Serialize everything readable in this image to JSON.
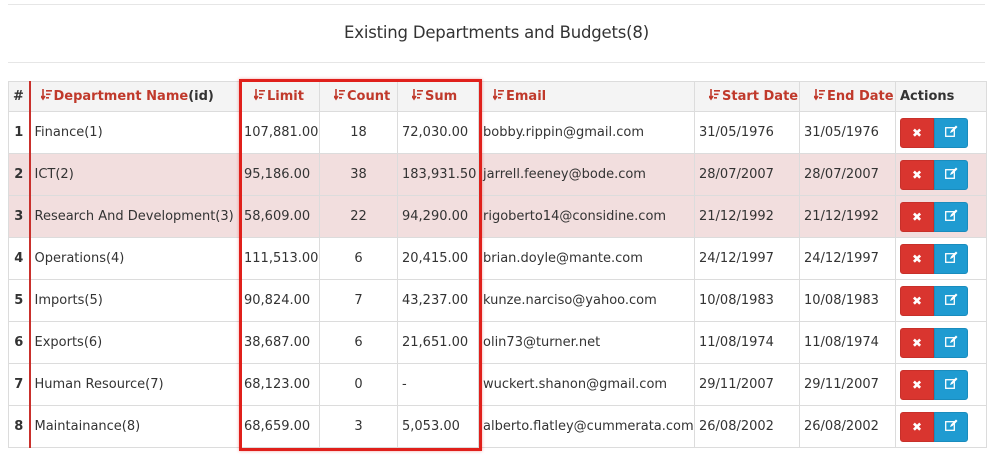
{
  "page_title": "Existing Departments and Budgets(8)",
  "colors": {
    "header_text": "#c0392b",
    "row_alt": "#f2dede",
    "delete_btn": "#d9352f",
    "edit_btn": "#1f9bd1",
    "highlight": "#e0201b"
  },
  "table": {
    "headers": {
      "hash": "#",
      "name": "Department Name",
      "name_suffix": "(id)",
      "limit": "Limit",
      "count": "Count",
      "sum": "Sum",
      "email": "Email",
      "start": "Start Date",
      "end": "End Date",
      "actions": "Actions"
    },
    "rows": [
      {
        "n": "1",
        "name": "Finance(1)",
        "limit": "107,881.00",
        "count": "18",
        "sum": "72,030.00",
        "email": "bobby.rippin@gmail.com",
        "start": "31/05/1976",
        "end": "31/05/1976"
      },
      {
        "n": "2",
        "name": "ICT(2)",
        "limit": "95,186.00",
        "count": "38",
        "sum": "183,931.50",
        "email": "jarrell.feeney@bode.com",
        "start": "28/07/2007",
        "end": "28/07/2007"
      },
      {
        "n": "3",
        "name": "Research And Development(3)",
        "limit": "58,609.00",
        "count": "22",
        "sum": "94,290.00",
        "email": "rigoberto14@considine.com",
        "start": "21/12/1992",
        "end": "21/12/1992"
      },
      {
        "n": "4",
        "name": "Operations(4)",
        "limit": "111,513.00",
        "count": "6",
        "sum": "20,415.00",
        "email": "brian.doyle@mante.com",
        "start": "24/12/1997",
        "end": "24/12/1997"
      },
      {
        "n": "5",
        "name": "Imports(5)",
        "limit": "90,824.00",
        "count": "7",
        "sum": "43,237.00",
        "email": "kunze.narciso@yahoo.com",
        "start": "10/08/1983",
        "end": "10/08/1983"
      },
      {
        "n": "6",
        "name": "Exports(6)",
        "limit": "38,687.00",
        "count": "6",
        "sum": "21,651.00",
        "email": "olin73@turner.net",
        "start": "11/08/1974",
        "end": "11/08/1974"
      },
      {
        "n": "7",
        "name": "Human Resource(7)",
        "limit": "68,123.00",
        "count": "0",
        "sum": "-",
        "email": "wuckert.shanon@gmail.com",
        "start": "29/11/2007",
        "end": "29/11/2007"
      },
      {
        "n": "8",
        "name": "Maintainance(8)",
        "limit": "68,659.00",
        "count": "3",
        "sum": "5,053.00",
        "email": "alberto.flatley@cummerata.com",
        "start": "26/08/2002",
        "end": "26/08/2002"
      }
    ]
  },
  "icons": {
    "sort": "sort-amount-down-icon",
    "delete": "times-icon",
    "edit": "edit-icon"
  }
}
